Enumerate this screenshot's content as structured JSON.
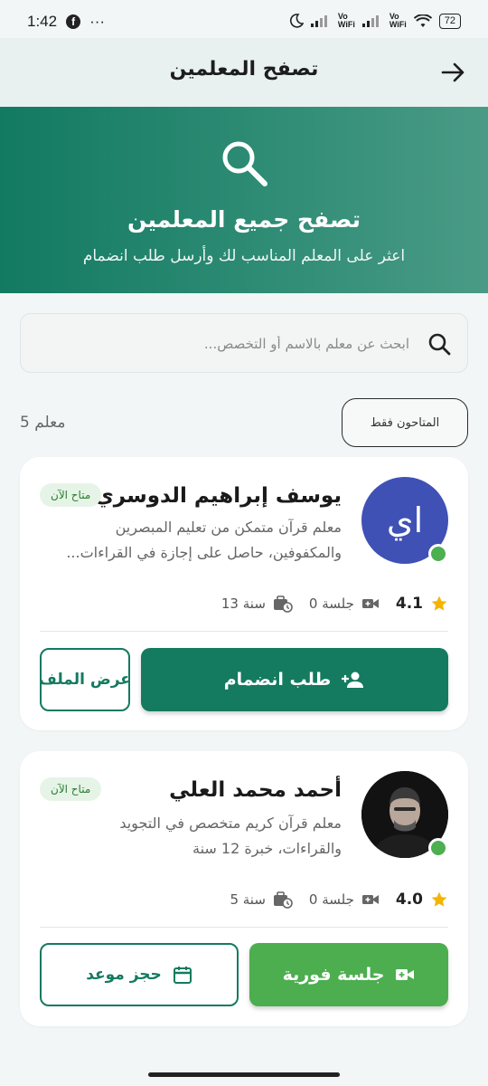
{
  "status_bar": {
    "time": "1:42",
    "dots": "···",
    "network1": "Vo\nWiFi",
    "network2": "Vo\nWiFi",
    "battery": "72"
  },
  "header": {
    "title": "تصفح المعلمين"
  },
  "hero": {
    "title": "تصفح جميع المعلمين",
    "subtitle": "اعثر على المعلم المناسب لك وأرسل طلب انضمام"
  },
  "search": {
    "placeholder": "ابحث عن معلم بالاسم أو التخصص..."
  },
  "filter": {
    "label": "المتاحون فقط"
  },
  "count": "5 معلم",
  "teachers": [
    {
      "name": "يوسف إبراهيم الدوسري",
      "initials": "اي",
      "badge": "متاح الآن",
      "description": "معلم قرآن متمكن من تعليم المبصرين والمكفوفين، حاصل على إجازة في القراءات...",
      "rating": "4.1",
      "sessions": "0 جلسة",
      "experience": "13 سنة",
      "primary_action": "طلب انضمام",
      "secondary_action": "عرض الملف"
    },
    {
      "name": "أحمد محمد العلي",
      "badge": "متاح الآن",
      "description": "معلم قرآن كريم متخصص في التجويد والقراءات، خبرة 12 سنة",
      "rating": "4.0",
      "sessions": "0 جلسة",
      "experience": "5 سنة",
      "primary_action": "جلسة فورية",
      "secondary_action": "حجز موعد"
    }
  ],
  "colors": {
    "primary": "#147a60",
    "accent_green": "#4cae4f",
    "star": "#f4b400",
    "avatar_bg": "#3f51b5"
  }
}
